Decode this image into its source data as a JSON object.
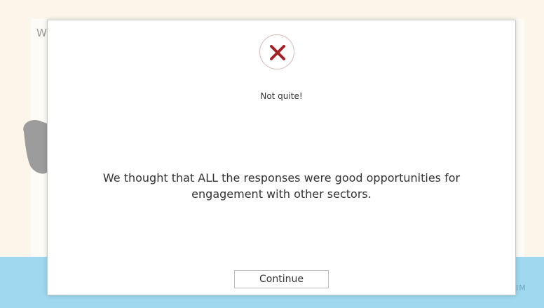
{
  "background": {
    "card_partial_text": "W",
    "floor_partial_text": "IM",
    "floor_small_text": ""
  },
  "dialog": {
    "status_icon": "close-icon",
    "status_icon_color": "#a32025",
    "heading": "Not quite!",
    "message": "We thought that ALL the responses were good opportunities for engagement with other sectors.",
    "continue_label": "Continue"
  }
}
